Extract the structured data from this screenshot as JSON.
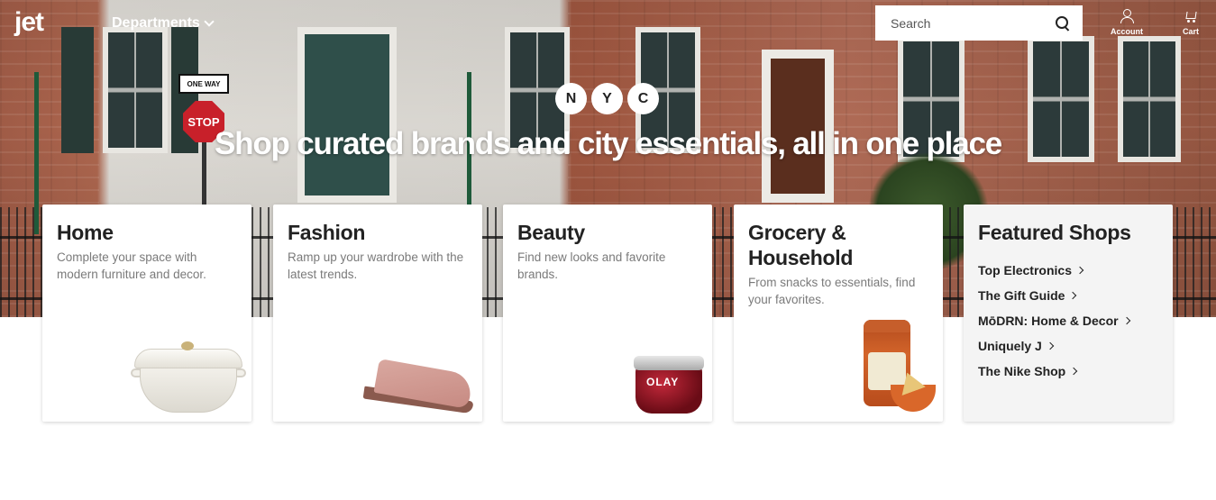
{
  "header": {
    "logo_text": "jet",
    "departments_label": "Departments",
    "search_placeholder": "Search",
    "account_label": "Account",
    "cart_label": "Cart"
  },
  "hero": {
    "badges": [
      "N",
      "Y",
      "C"
    ],
    "headline": "Shop curated brands and city essentials, all in one place"
  },
  "cards": [
    {
      "title": "Home",
      "description": "Complete your space with modern furniture and decor.",
      "image": "cream-dutch-oven-pot"
    },
    {
      "title": "Fashion",
      "description": "Ramp up your wardrobe with the latest trends.",
      "image": "pink-suede-mule-shoe"
    },
    {
      "title": "Beauty",
      "description": "Find new looks and favorite brands.",
      "image": "olay-red-moisturizer-jar",
      "image_text": "OLAY"
    },
    {
      "title": "Grocery & Household",
      "description": "From snacks to essentials, find your favorites.",
      "image": "mango-chili-salsa-jar-with-chips"
    }
  ],
  "featured": {
    "title": "Featured Shops",
    "links": [
      "Top Electronics",
      "The Gift Guide",
      "MōDRN: Home & Decor",
      "Uniquely J",
      "The Nike Shop"
    ]
  },
  "colors": {
    "card_bg": "#ffffff",
    "featured_bg": "#f4f4f4",
    "text_dark": "#222222",
    "text_muted": "#7a7a7a"
  }
}
